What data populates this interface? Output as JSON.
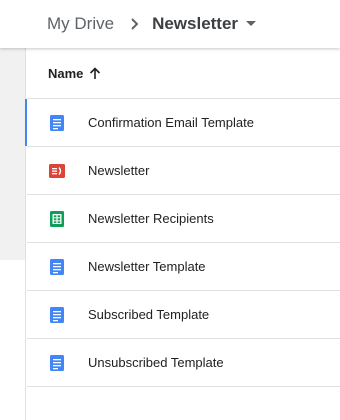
{
  "breadcrumb": {
    "root": "My Drive",
    "current": "Newsletter"
  },
  "list": {
    "column_header": "Name",
    "sort_direction": "ascending",
    "files": [
      {
        "name": "Confirmation Email Template",
        "type": "doc",
        "icon": "google-docs-icon",
        "selected": true
      },
      {
        "name": "Newsletter",
        "type": "slides",
        "icon": "google-slides-icon",
        "selected": false
      },
      {
        "name": "Newsletter Recipients",
        "type": "sheet",
        "icon": "google-sheets-icon",
        "selected": false
      },
      {
        "name": "Newsletter Template",
        "type": "doc",
        "icon": "google-docs-icon",
        "selected": false
      },
      {
        "name": "Subscribed Template",
        "type": "doc",
        "icon": "google-docs-icon",
        "selected": false
      },
      {
        "name": "Unsubscribed Template",
        "type": "doc",
        "icon": "google-docs-icon",
        "selected": false
      }
    ]
  },
  "colors": {
    "doc": "#4285f4",
    "slides": "#db4437",
    "sheet": "#0f9d58",
    "selection": "#4285f4"
  }
}
